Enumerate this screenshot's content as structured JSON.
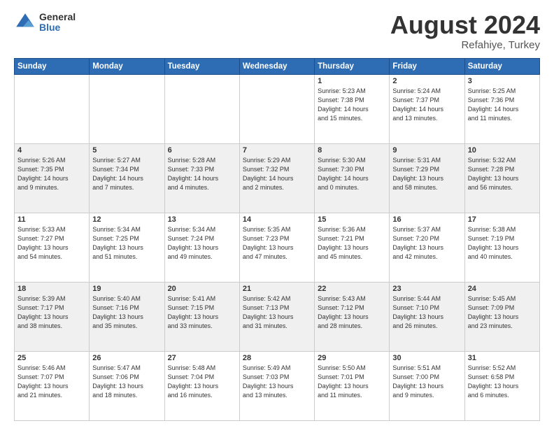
{
  "logo": {
    "general": "General",
    "blue": "Blue"
  },
  "header": {
    "month": "August 2024",
    "location": "Refahiye, Turkey"
  },
  "weekdays": [
    "Sunday",
    "Monday",
    "Tuesday",
    "Wednesday",
    "Thursday",
    "Friday",
    "Saturday"
  ],
  "rows": [
    [
      {
        "day": "",
        "info": ""
      },
      {
        "day": "",
        "info": ""
      },
      {
        "day": "",
        "info": ""
      },
      {
        "day": "",
        "info": ""
      },
      {
        "day": "1",
        "info": "Sunrise: 5:23 AM\nSunset: 7:38 PM\nDaylight: 14 hours\nand 15 minutes."
      },
      {
        "day": "2",
        "info": "Sunrise: 5:24 AM\nSunset: 7:37 PM\nDaylight: 14 hours\nand 13 minutes."
      },
      {
        "day": "3",
        "info": "Sunrise: 5:25 AM\nSunset: 7:36 PM\nDaylight: 14 hours\nand 11 minutes."
      }
    ],
    [
      {
        "day": "4",
        "info": "Sunrise: 5:26 AM\nSunset: 7:35 PM\nDaylight: 14 hours\nand 9 minutes."
      },
      {
        "day": "5",
        "info": "Sunrise: 5:27 AM\nSunset: 7:34 PM\nDaylight: 14 hours\nand 7 minutes."
      },
      {
        "day": "6",
        "info": "Sunrise: 5:28 AM\nSunset: 7:33 PM\nDaylight: 14 hours\nand 4 minutes."
      },
      {
        "day": "7",
        "info": "Sunrise: 5:29 AM\nSunset: 7:32 PM\nDaylight: 14 hours\nand 2 minutes."
      },
      {
        "day": "8",
        "info": "Sunrise: 5:30 AM\nSunset: 7:30 PM\nDaylight: 14 hours\nand 0 minutes."
      },
      {
        "day": "9",
        "info": "Sunrise: 5:31 AM\nSunset: 7:29 PM\nDaylight: 13 hours\nand 58 minutes."
      },
      {
        "day": "10",
        "info": "Sunrise: 5:32 AM\nSunset: 7:28 PM\nDaylight: 13 hours\nand 56 minutes."
      }
    ],
    [
      {
        "day": "11",
        "info": "Sunrise: 5:33 AM\nSunset: 7:27 PM\nDaylight: 13 hours\nand 54 minutes."
      },
      {
        "day": "12",
        "info": "Sunrise: 5:34 AM\nSunset: 7:25 PM\nDaylight: 13 hours\nand 51 minutes."
      },
      {
        "day": "13",
        "info": "Sunrise: 5:34 AM\nSunset: 7:24 PM\nDaylight: 13 hours\nand 49 minutes."
      },
      {
        "day": "14",
        "info": "Sunrise: 5:35 AM\nSunset: 7:23 PM\nDaylight: 13 hours\nand 47 minutes."
      },
      {
        "day": "15",
        "info": "Sunrise: 5:36 AM\nSunset: 7:21 PM\nDaylight: 13 hours\nand 45 minutes."
      },
      {
        "day": "16",
        "info": "Sunrise: 5:37 AM\nSunset: 7:20 PM\nDaylight: 13 hours\nand 42 minutes."
      },
      {
        "day": "17",
        "info": "Sunrise: 5:38 AM\nSunset: 7:19 PM\nDaylight: 13 hours\nand 40 minutes."
      }
    ],
    [
      {
        "day": "18",
        "info": "Sunrise: 5:39 AM\nSunset: 7:17 PM\nDaylight: 13 hours\nand 38 minutes."
      },
      {
        "day": "19",
        "info": "Sunrise: 5:40 AM\nSunset: 7:16 PM\nDaylight: 13 hours\nand 35 minutes."
      },
      {
        "day": "20",
        "info": "Sunrise: 5:41 AM\nSunset: 7:15 PM\nDaylight: 13 hours\nand 33 minutes."
      },
      {
        "day": "21",
        "info": "Sunrise: 5:42 AM\nSunset: 7:13 PM\nDaylight: 13 hours\nand 31 minutes."
      },
      {
        "day": "22",
        "info": "Sunrise: 5:43 AM\nSunset: 7:12 PM\nDaylight: 13 hours\nand 28 minutes."
      },
      {
        "day": "23",
        "info": "Sunrise: 5:44 AM\nSunset: 7:10 PM\nDaylight: 13 hours\nand 26 minutes."
      },
      {
        "day": "24",
        "info": "Sunrise: 5:45 AM\nSunset: 7:09 PM\nDaylight: 13 hours\nand 23 minutes."
      }
    ],
    [
      {
        "day": "25",
        "info": "Sunrise: 5:46 AM\nSunset: 7:07 PM\nDaylight: 13 hours\nand 21 minutes."
      },
      {
        "day": "26",
        "info": "Sunrise: 5:47 AM\nSunset: 7:06 PM\nDaylight: 13 hours\nand 18 minutes."
      },
      {
        "day": "27",
        "info": "Sunrise: 5:48 AM\nSunset: 7:04 PM\nDaylight: 13 hours\nand 16 minutes."
      },
      {
        "day": "28",
        "info": "Sunrise: 5:49 AM\nSunset: 7:03 PM\nDaylight: 13 hours\nand 13 minutes."
      },
      {
        "day": "29",
        "info": "Sunrise: 5:50 AM\nSunset: 7:01 PM\nDaylight: 13 hours\nand 11 minutes."
      },
      {
        "day": "30",
        "info": "Sunrise: 5:51 AM\nSunset: 7:00 PM\nDaylight: 13 hours\nand 9 minutes."
      },
      {
        "day": "31",
        "info": "Sunrise: 5:52 AM\nSunset: 6:58 PM\nDaylight: 13 hours\nand 6 minutes."
      }
    ]
  ]
}
